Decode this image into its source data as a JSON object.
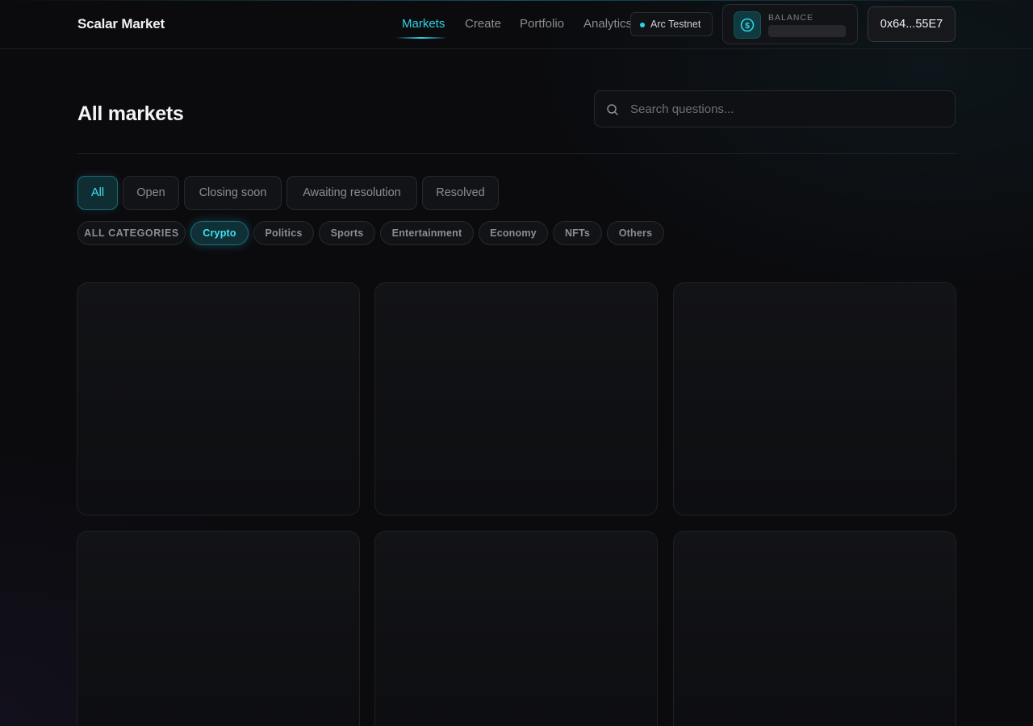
{
  "app": {
    "brand": "Scalar Market"
  },
  "nav": {
    "items": [
      {
        "label": "Markets",
        "active": true
      },
      {
        "label": "Create",
        "active": false
      },
      {
        "label": "Portfolio",
        "active": false
      },
      {
        "label": "Analytics",
        "active": false
      }
    ]
  },
  "network": {
    "label": "Arc Testnet",
    "status_color": "#2fd3e6"
  },
  "balance": {
    "label": "BALANCE",
    "icon": "dollar-coin-icon",
    "value_loading": true
  },
  "wallet": {
    "address": "0x64...55E7"
  },
  "page": {
    "title": "All markets"
  },
  "search": {
    "placeholder": "Search questions...",
    "value": "",
    "icon": "search-icon"
  },
  "status_filters": [
    {
      "label": "All",
      "active": true
    },
    {
      "label": "Open",
      "active": false
    },
    {
      "label": "Closing soon",
      "active": false
    },
    {
      "label": "Awaiting resolution",
      "active": false
    },
    {
      "label": "Resolved",
      "active": false
    }
  ],
  "categories": [
    {
      "label": "ALL CATEGORIES",
      "active": false
    },
    {
      "label": "Crypto",
      "active": true
    },
    {
      "label": "Politics",
      "active": false
    },
    {
      "label": "Sports",
      "active": false
    },
    {
      "label": "Entertainment",
      "active": false
    },
    {
      "label": "Economy",
      "active": false
    },
    {
      "label": "NFTs",
      "active": false
    },
    {
      "label": "Others",
      "active": false
    }
  ],
  "market_cards": {
    "loading": true,
    "count_visible": 6
  },
  "colors": {
    "accent": "#2fd3e6",
    "background": "#0b0b0e"
  }
}
